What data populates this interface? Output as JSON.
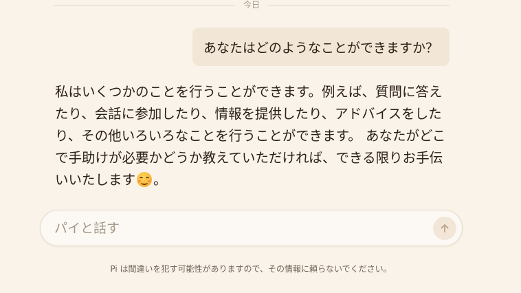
{
  "chat": {
    "date_divider": "今日",
    "user_message": "あなたはどのようなことができますか？",
    "ai_message": "私はいくつかのことを行うことができます。例えば、質問に答えたり、会話に参加したり、情報を提供したり、アドバイスをしたり、その他いろいろなことを行うことができます。 あなたがどこで手助けが必要かどうか教えていただければ、できる限りお手伝いいたします",
    "ai_message_end": "。",
    "emoji_icon": "smiling-face-emoji"
  },
  "composer": {
    "placeholder": "パイと話す",
    "value": "",
    "send_icon": "arrow-up-icon"
  },
  "footer": {
    "disclaimer": "Pi は間違いを犯す可能性がありますので、その情報に頼らないでください。"
  },
  "colors": {
    "background": "#faf3ea",
    "user_bubble": "#f2e6d6",
    "send_button": "#f2e6d8",
    "text": "#2b2016",
    "muted_text": "#a49786"
  }
}
